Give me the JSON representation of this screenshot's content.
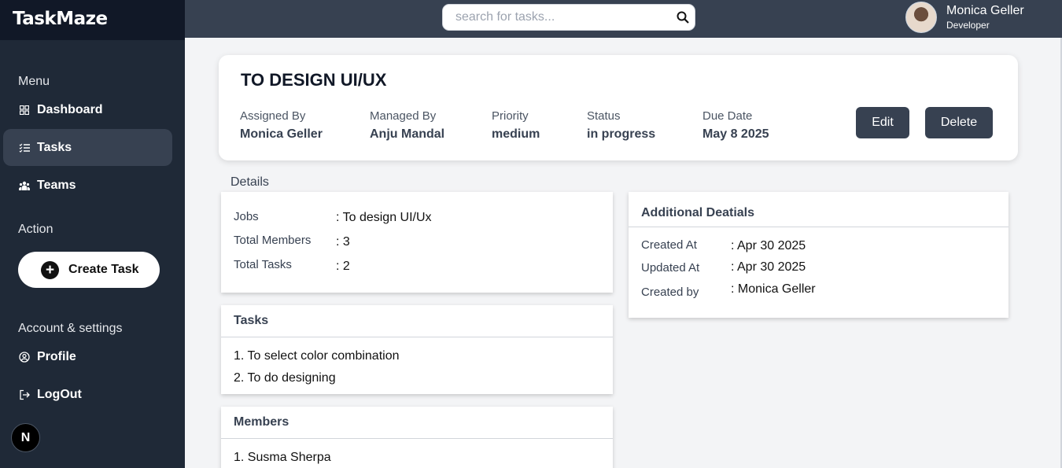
{
  "app": {
    "brand": "TaskMaze"
  },
  "sidebar": {
    "menu_label": "Menu",
    "menu_items": [
      {
        "label": "Dashboard",
        "icon": "dashboard-icon"
      },
      {
        "label": "Tasks",
        "icon": "tasks-list-icon",
        "active": true
      },
      {
        "label": "Teams",
        "icon": "teams-icon"
      }
    ],
    "action_label": "Action",
    "create_task_label": "Create Task",
    "account_label": "Account & settings",
    "account_items": [
      {
        "label": "Profile",
        "icon": "profile-icon"
      },
      {
        "label": "LogOut",
        "icon": "logout-icon"
      }
    ],
    "badge_letter": "N"
  },
  "topbar": {
    "search_placeholder": "search for tasks...",
    "user_name": "Monica Geller",
    "user_role": "Developer"
  },
  "task": {
    "title": "TO DESIGN UI/UX",
    "meta": [
      {
        "label": "Assigned By",
        "value": "Monica Geller"
      },
      {
        "label": "Managed By",
        "value": "Anju Mandal"
      },
      {
        "label": "Priority",
        "value": "medium"
      },
      {
        "label": "Status",
        "value": "in progress"
      },
      {
        "label": "Due Date",
        "value": "May 8 2025"
      }
    ],
    "edit_label": "Edit",
    "delete_label": "Delete"
  },
  "details": {
    "section_label": "Details",
    "rows": [
      {
        "key": "Jobs",
        "value": ": To design UI/Ux"
      },
      {
        "key": "Total Members",
        "value": ": 3"
      },
      {
        "key": "Total Tasks",
        "value": ": 2"
      }
    ]
  },
  "tasks_card": {
    "title": "Tasks",
    "items": [
      "1. To select color combination",
      "2. To do designing"
    ]
  },
  "members_card": {
    "title": "Members",
    "items": [
      "1. Susma Sherpa"
    ]
  },
  "additional": {
    "title": "Additional Deatials",
    "rows": [
      {
        "key": "Created At",
        "value": ": Apr 30 2025"
      },
      {
        "key": "Updated At",
        "value": ": Apr 30 2025"
      },
      {
        "key": "Created by",
        "value": ": Monica Geller"
      }
    ]
  }
}
